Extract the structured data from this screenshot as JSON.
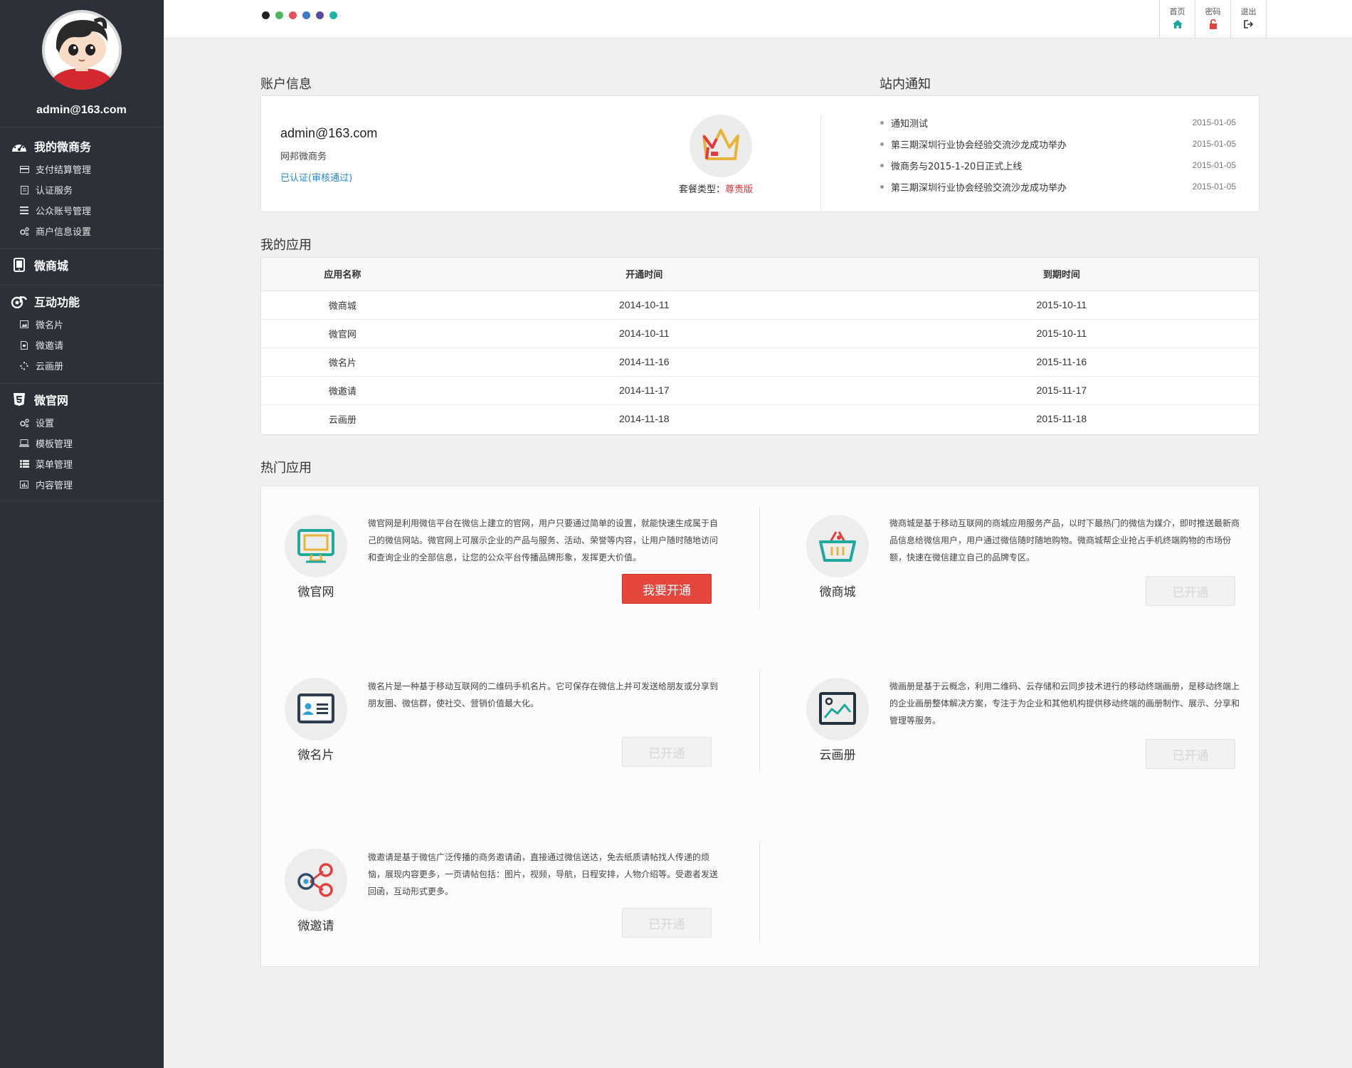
{
  "profile": {
    "email": "admin@163.com"
  },
  "sidebar": {
    "groups": [
      {
        "title": "我的微商务",
        "icon": "dashboard-icon",
        "items": [
          {
            "label": "支付结算管理",
            "icon": "credit-card-icon"
          },
          {
            "label": "认证服务",
            "icon": "document-icon"
          },
          {
            "label": "公众账号管理",
            "icon": "list-icon"
          },
          {
            "label": "商户信息设置",
            "icon": "cogs-icon"
          }
        ]
      },
      {
        "title": "微商城",
        "icon": "tablet-icon",
        "items": []
      },
      {
        "title": "互动功能",
        "icon": "weibo-icon",
        "items": [
          {
            "label": "微名片",
            "icon": "picture-icon"
          },
          {
            "label": "微邀请",
            "icon": "file-icon"
          },
          {
            "label": "云画册",
            "icon": "spinner-icon"
          }
        ]
      },
      {
        "title": "微官网",
        "icon": "html5-icon",
        "items": [
          {
            "label": "设置",
            "icon": "cogs-icon"
          },
          {
            "label": "模板管理",
            "icon": "laptop-icon"
          },
          {
            "label": "菜单管理",
            "icon": "th-list-icon"
          },
          {
            "label": "内容管理",
            "icon": "bar-chart-icon"
          }
        ]
      }
    ]
  },
  "topbar": {
    "theme_colors": [
      "#222222",
      "#4cb85c",
      "#e2525d",
      "#3a78c9",
      "#5a4b9e",
      "#1db3a6"
    ],
    "nav": [
      {
        "label": "首页",
        "icon": "home-icon",
        "color": "#1ba79c"
      },
      {
        "label": "密码",
        "icon": "unlock-icon",
        "color": "#e2403d"
      },
      {
        "label": "退出",
        "icon": "sign-out-icon",
        "color": "#333333"
      }
    ]
  },
  "account": {
    "section_title": "账户信息",
    "email": "admin@163.com",
    "company": "网邦微商务",
    "verify_status": "已认证(审核通过)",
    "package_label": "套餐类型：",
    "package_value": "尊贵版"
  },
  "notices": {
    "section_title": "站内通知",
    "items": [
      {
        "title": "通知测试",
        "date": "2015-01-05"
      },
      {
        "title": "第三期深圳行业协会经验交流沙龙成功举办",
        "date": "2015-01-05"
      },
      {
        "title": "微商务与2015-1-20日正式上线",
        "date": "2015-01-05"
      },
      {
        "title": "第三期深圳行业协会经验交流沙龙成功举办",
        "date": "2015-01-05"
      }
    ]
  },
  "my_apps": {
    "section_title": "我的应用",
    "columns": [
      "应用名称",
      "开通时间",
      "到期时间"
    ],
    "rows": [
      [
        "微商城",
        "2014-10-11",
        "2015-10-11"
      ],
      [
        "微官网",
        "2014-10-11",
        "2015-10-11"
      ],
      [
        "微名片",
        "2014-11-16",
        "2015-11-16"
      ],
      [
        "微邀请",
        "2014-11-17",
        "2015-11-17"
      ],
      [
        "云画册",
        "2014-11-18",
        "2015-11-18"
      ]
    ]
  },
  "hot_apps": {
    "section_title": "热门应用",
    "items": [
      {
        "name": "微官网",
        "icon": "monitor-icon",
        "button": "我要开通",
        "status": "available",
        "desc": "微官网是利用微信平台在微信上建立的官网，用户只要通过简单的设置，就能快速生成属于自己的微信网站。微官网上可展示企业的产品与服务、活动、荣誉等内容，让用户随时随地访问和查询企业的全部信息，让您的公众平台传播品牌形象，发挥更大价值。"
      },
      {
        "name": "微商城",
        "icon": "shopping-basket-icon",
        "button": "已开通",
        "status": "opened",
        "desc": "微商城是基于移动互联网的商城应用服务产品，以时下最热门的微信为媒介，即时推送最新商品信息给微信用户，用户通过微信随时随地购物。微商城帮企业抢占手机终端购物的市场份额，快速在微信建立自己的品牌专区。"
      },
      {
        "name": "微名片",
        "icon": "id-card-icon",
        "button": "已开通",
        "status": "opened",
        "desc": "微名片是一种基于移动互联网的二维码手机名片。它可保存在微信上并可发送给朋友或分享到朋友圈、微信群，使社交、营销价值最大化。"
      },
      {
        "name": "云画册",
        "icon": "image-icon",
        "button": "已开通",
        "status": "opened",
        "desc": "微画册是基于云概念，利用二维码、云存储和云同步技术进行的移动终端画册，是移动终端上的企业画册整体解决方案，专注于为企业和其他机构提供移动终端的画册制作、展示、分享和管理等服务。"
      },
      {
        "name": "微邀请",
        "icon": "share-icon",
        "button": "已开通",
        "status": "opened",
        "desc": "微邀请是基于微信广泛传播的商务邀请函，直接通过微信送达，免去纸质请帖找人传递的烦恼，展现内容更多，一页请帖包括：图片，视频，导航，日程安排，人物介绍等。受邀者发送回函，互动形式更多。"
      }
    ]
  }
}
